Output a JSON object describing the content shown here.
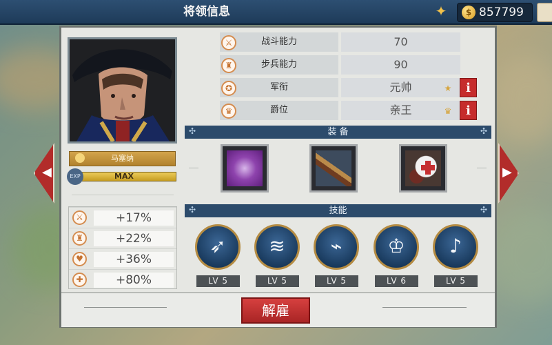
{
  "header": {
    "title": "将领信息",
    "currency": "857799"
  },
  "left_panel": {
    "general_name": "马塞纳",
    "exp_label": "EXP",
    "exp_value": "MAX",
    "attributes": [
      {
        "icon": "crossed-swords-icon",
        "value": "+17%"
      },
      {
        "icon": "infantry-icon",
        "value": "+22%"
      },
      {
        "icon": "heart-icon",
        "value": "+36%"
      },
      {
        "icon": "health-icon",
        "value": "+80%"
      }
    ]
  },
  "stats": [
    {
      "label": "战斗能力",
      "value": "70",
      "icon": "crossed-swords-icon"
    },
    {
      "label": "步兵能力",
      "value": "90",
      "icon": "infantry-icon"
    },
    {
      "label": "军衔",
      "value": "元帅",
      "icon": "rank-icon"
    },
    {
      "label": "爵位",
      "value": "亲王",
      "icon": "crown-icon"
    }
  ],
  "sections": {
    "equipment": "装 备",
    "skills": "技能"
  },
  "equipment": [
    {
      "name": "purple-heart-medal-icon"
    },
    {
      "name": "musket-icon"
    },
    {
      "name": "medical-cart-icon"
    }
  ],
  "skills": [
    {
      "icon": "charge-icon",
      "level": "LV 5"
    },
    {
      "icon": "infantry-volley-icon",
      "level": "LV 5"
    },
    {
      "icon": "trench-soldier-icon",
      "level": "LV 5"
    },
    {
      "icon": "laurel-guard-icon",
      "level": "LV 6"
    },
    {
      "icon": "bugle-icon",
      "level": "LV 5"
    }
  ],
  "actions": {
    "dismiss": "解雇"
  }
}
